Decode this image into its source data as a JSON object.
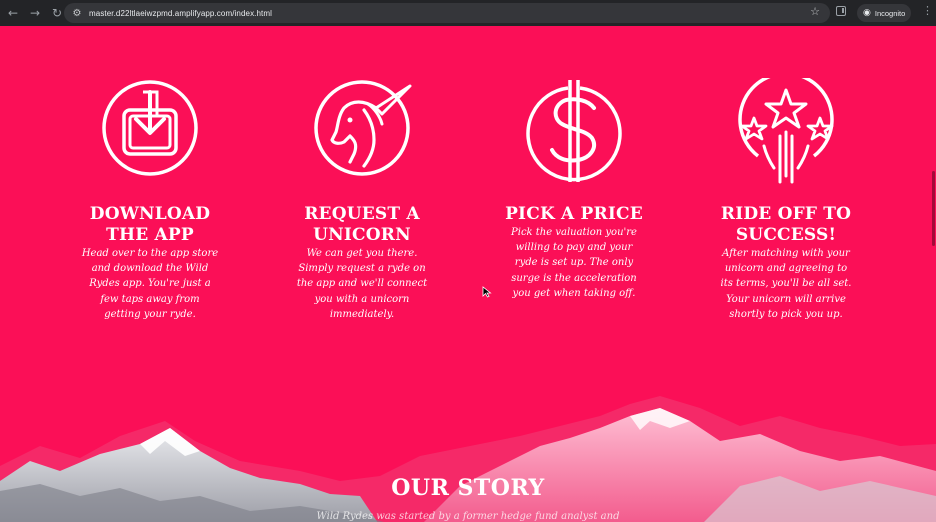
{
  "browser": {
    "back_icon": "arrow-left-icon",
    "forward_icon": "arrow-right-icon",
    "reload_icon": "reload-icon",
    "url": "master.d22ltlaeiwzpmd.amplifyapp.com/index.html",
    "mode_label": "Incognito"
  },
  "steps": [
    {
      "title_line1": "DOWNLOAD",
      "title_line2": "THE APP",
      "icon": "download-icon",
      "text": [
        "Head over to the app store",
        "and download the Wild",
        "Rydes app. You're just a",
        "few taps away from",
        "getting your ryde."
      ]
    },
    {
      "title_line1": "REQUEST A",
      "title_line2": "UNICORN",
      "icon": "unicorn-icon",
      "text": [
        "We can get you there.",
        "Simply request a ryde on",
        "the app and we'll connect",
        "you with a unicorn",
        "immediately."
      ]
    },
    {
      "title_line1": "PICK A PRICE",
      "title_line2": "",
      "icon": "dollar-icon",
      "text": [
        "Pick the valuation you're",
        "willing to pay and your",
        "ryde is set up. The only",
        "surge is the acceleration",
        "you get when taking off."
      ]
    },
    {
      "title_line1": "RIDE OFF TO",
      "title_line2": "SUCCESS!",
      "icon": "shooting-stars-icon",
      "text": [
        "After matching with your",
        "unicorn and agreeing to",
        "its terms, you'll be all set.",
        "Your unicorn will arrive",
        "shortly to pick you up."
      ]
    }
  ],
  "story": {
    "title": "OUR STORY",
    "text": "Wild Rydes was started by a former hedge fund analyst and"
  },
  "colors": {
    "background": "#fb0f57",
    "text": "#ffffff"
  }
}
